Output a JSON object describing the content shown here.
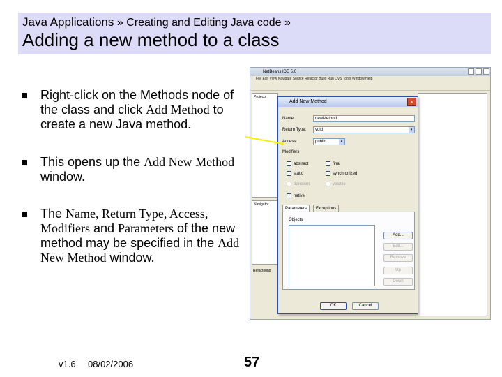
{
  "header": {
    "breadcrumb_main": "Java Applications",
    "breadcrumb_sep1": "»",
    "breadcrumb_sub": "Creating and Editing Java code",
    "breadcrumb_sep2": "»",
    "title": "Adding a new method to a class"
  },
  "bullets": {
    "b1": {
      "pre": "Right-click on the Methods node of the class and click ",
      "term": "Add Method",
      "post": " to create a new Java method."
    },
    "b2": {
      "pre": "This opens up the ",
      "term": "Add New Method",
      "post": " window."
    },
    "b3": {
      "pre": "The ",
      "t1": "Name, Return Type, Access, Modifiers",
      "mid1": " and ",
      "t2": "Parameters",
      "mid2": " of the new method may be specified in the ",
      "t3": "Add New Method",
      "post": " window."
    }
  },
  "footer": {
    "version": "v1.6",
    "date": "08/02/2006",
    "page": "57"
  },
  "ide": {
    "title": "NetBeans IDE 5.0",
    "menu": "File  Edit  View  Navigate  Source  Refactor  Build  Run  CVS  Tools  Window  Help",
    "projects_label": "Projects",
    "navigator_label": "Navigator",
    "refactoring_label": "Refactoring"
  },
  "dialog": {
    "title": "Add New Method",
    "close_glyph": "×",
    "name_label": "Name:",
    "name_value": "newMethod",
    "return_type_label": "Return Type:",
    "return_type_value": "void",
    "access_label": "Access:",
    "access_value": "public",
    "combo_arrow": "▾",
    "modifiers_label": "Modifiers",
    "mod_abstract": "abstract",
    "mod_final": "final",
    "mod_static": "static",
    "mod_synchronized": "synchronized",
    "mod_transient": "transient",
    "mod_volatile": "volatile",
    "mod_native": "native",
    "tab_parameters": "Parameters",
    "tab_exceptions": "Exceptions",
    "objects_label": "Objects",
    "btn_add": "Add...",
    "btn_edit": "Edit...",
    "btn_remove": "Remove",
    "btn_up": "Up",
    "btn_down": "Down",
    "btn_ok": "OK",
    "btn_cancel": "Cancel"
  },
  "colors": {
    "header_bg": "#dcdcf8",
    "callout": "#f3f000",
    "dialog_border": "#2a4fae"
  }
}
